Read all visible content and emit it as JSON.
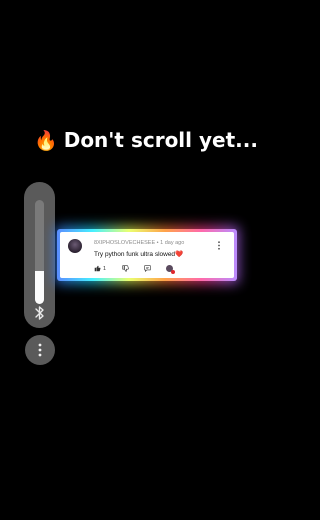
{
  "overlay": {
    "emoji": "🔥",
    "text": "Don't scroll yet..."
  },
  "volume": {
    "level_fraction": 0.32
  },
  "comment": {
    "username": "8XIPHOSLOVECHESEE",
    "separator": "•",
    "time": "1 day ago",
    "text": "Try python funk ultra slowed",
    "heart": "❤️",
    "likes": "1"
  },
  "icons": {
    "volume_icon": "bluetooth-icon",
    "menu": "more-vertical-icon",
    "like": "thumbs-up-icon",
    "dislike": "thumbs-down-icon",
    "reply": "reply-icon",
    "creator": "creator-heart-icon"
  },
  "colors": {
    "background": "#000000",
    "pill": "#5a5a5a",
    "volume_fill": "#fbfbfb",
    "heart": "#e0262e"
  }
}
